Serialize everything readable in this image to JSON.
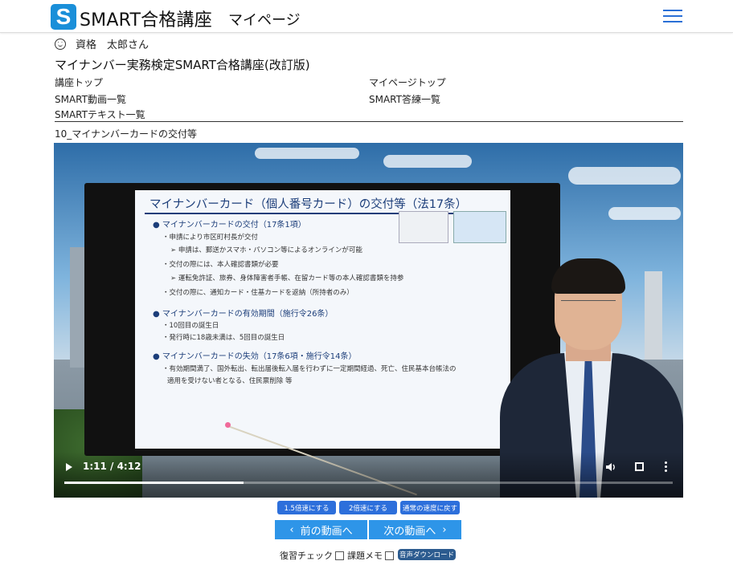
{
  "header": {
    "logo_letter": "S",
    "app_title": "SMART合格講座",
    "subtitle": "マイページ",
    "menu_icon": "hamburger-menu-icon",
    "accent_color": "#1a8fd9"
  },
  "user": {
    "icon": "smiley-icon",
    "name": "資格　太郎さん"
  },
  "course": {
    "title": "マイナンバー実務検定SMART合格講座(改訂版)"
  },
  "nav": {
    "course_top": "講座トップ",
    "mypage_top": "マイページトップ",
    "video_list": "SMART動画一覧",
    "answer_list": "SMART答練一覧",
    "text_list": "SMARTテキスト一覧"
  },
  "video": {
    "title": "10_マイナンバーカードの交付等",
    "current_time": "1:11",
    "duration": "4:12",
    "time_display": "1:11 / 4:12",
    "progress": 0.295,
    "slide": {
      "heading": "マイナンバーカード（個人番号カード）の交付等（法17条）",
      "lines": [
        "● マイナンバーカードの交付（17条1項）",
        "・申請により市区町村長が交付",
        "➢ 申請は、郵送かスマホ・パソコン等によるオンラインが可能",
        "・交付の際には、本人確認書類が必要",
        "➢ 運転免許証、旅券、身体障害者手帳、在留カード等の本人確認書類を持参",
        "・交付の際に、通知カード・住基カードを返納（所持者のみ）",
        "● マイナンバーカードの有効期間（施行令26条）",
        "・10回目の誕生日",
        "・発行時に18歳未満は、5回目の誕生日",
        "● マイナンバーカードの失効（17条6項・施行令14条）",
        "・有効期間満了、国外転出、転出届後転入届を行わずに一定期間経過、死亡、住民基本台帳法の",
        "適用を受けない者となる、住民票削除 等"
      ]
    },
    "icons": {
      "play": "play-icon",
      "volume": "volume-icon",
      "fullscreen": "fullscreen-icon",
      "more": "more-options-icon"
    }
  },
  "speed": {
    "x15": "1.5倍速にする",
    "x2": "2倍速にする",
    "normal": "通常の速度に戻す",
    "color": "#2d6fdb"
  },
  "pager": {
    "prev": "前の動画へ",
    "next": "次の動画へ",
    "prev_icon": "chevron-left-icon",
    "next_icon": "chevron-right-icon",
    "color": "#2e95e8"
  },
  "footer": {
    "review_check": "復習チェック",
    "memo": "課題メモ",
    "audio_download": "音声ダウンロード"
  }
}
